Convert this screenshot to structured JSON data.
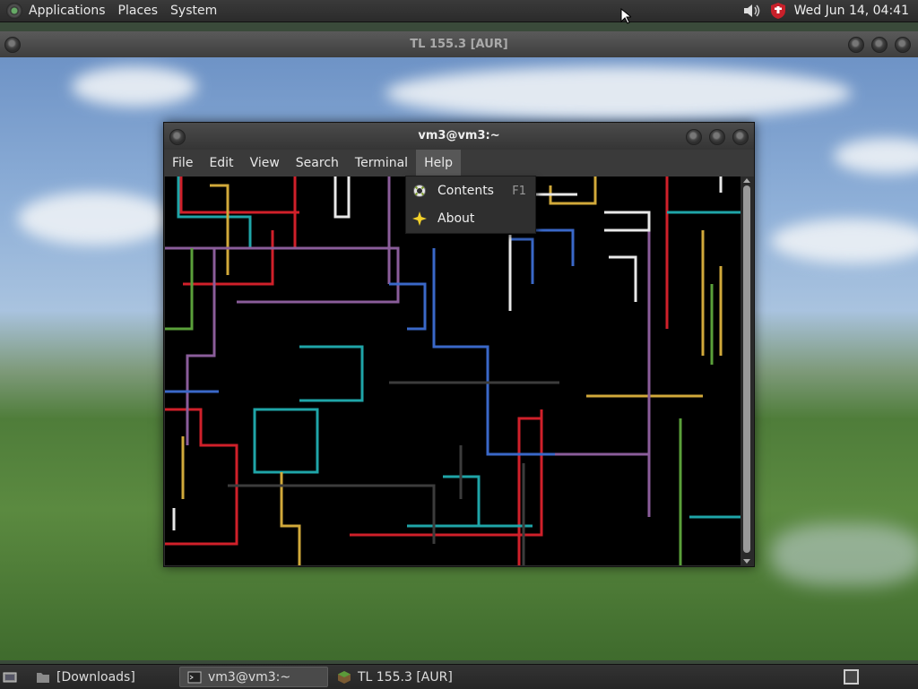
{
  "top_panel": {
    "menus": [
      "Applications",
      "Places",
      "System"
    ],
    "clock": "Wed Jun 14, 04:41"
  },
  "background_window": {
    "title": "TL 155.3 [AUR]"
  },
  "terminal": {
    "title": "vm3@vm3:~",
    "menus": [
      "File",
      "Edit",
      "View",
      "Search",
      "Terminal",
      "Help"
    ],
    "active_menu": "Help"
  },
  "help_menu": {
    "items": [
      {
        "label": "Contents",
        "accelerator": "F1",
        "icon": "help-lifebuoy-icon"
      },
      {
        "label": "About",
        "accelerator": "",
        "icon": "about-star-icon"
      }
    ]
  },
  "taskbar": {
    "tasks": [
      {
        "label": "[Downloads]",
        "icon": "folder-icon",
        "active": false
      },
      {
        "label": "vm3@vm3:~",
        "icon": "terminal-icon",
        "active": true
      },
      {
        "label": "TL 155.3 [AUR]",
        "icon": "minecraft-block-icon",
        "active": false
      }
    ]
  },
  "colors": {
    "red": "#d0202a",
    "cyan": "#1fa5a8",
    "yellow": "#d1a93a",
    "purple": "#8a5d9a",
    "blue": "#3a68c8",
    "green": "#5aa03a",
    "white": "#e8e8e8",
    "gray": "#3c3c3c"
  }
}
